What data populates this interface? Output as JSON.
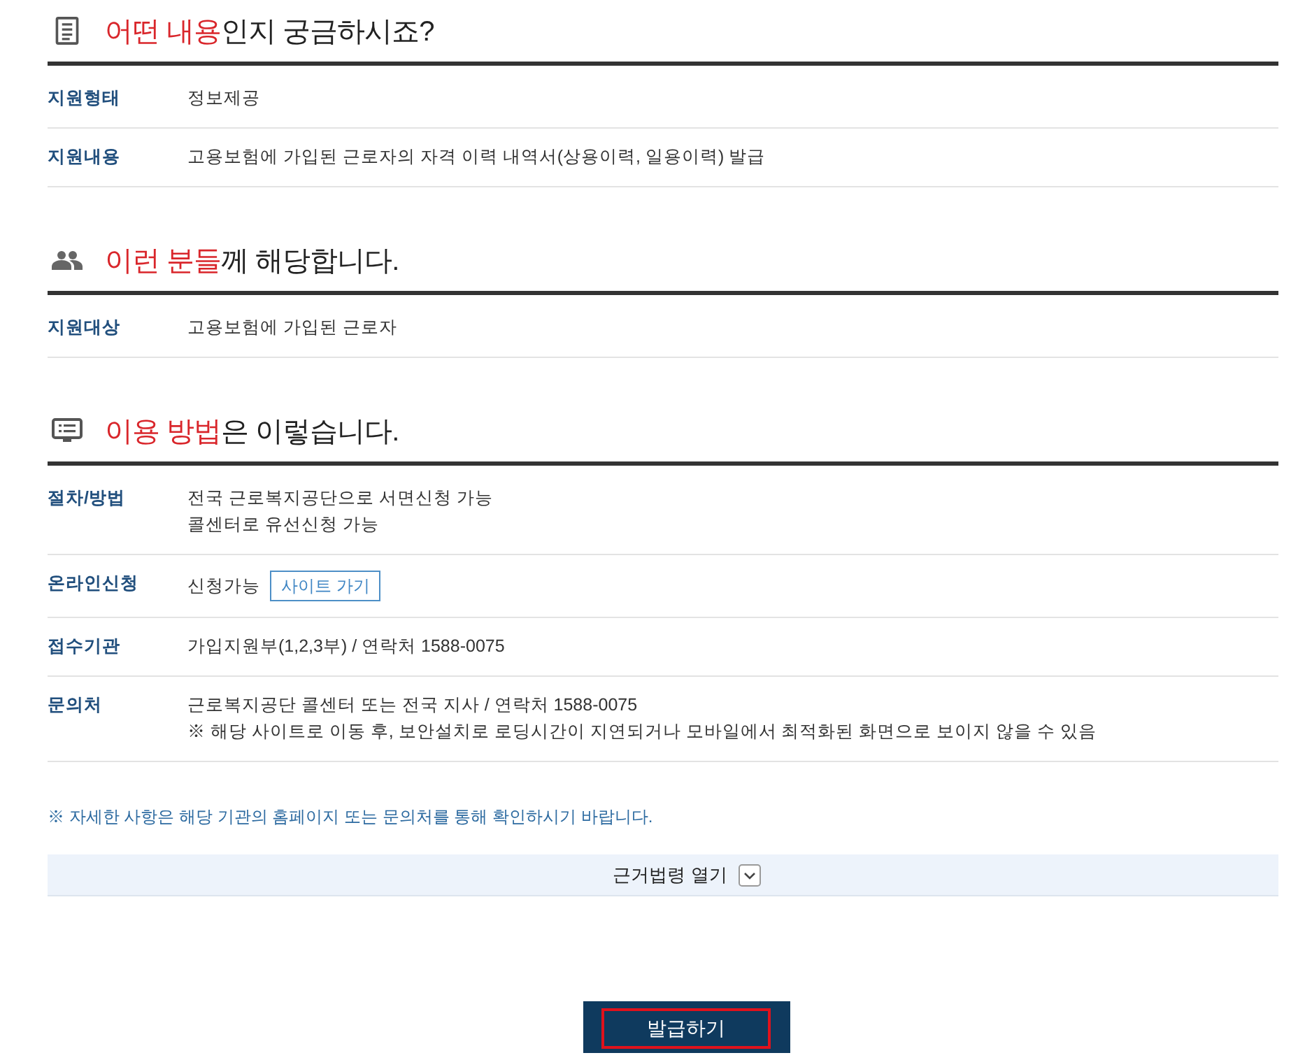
{
  "sections": [
    {
      "kind": "document",
      "title_highlight": "어떤 내용",
      "title_rest": "인지 궁금하시죠?",
      "rows": [
        {
          "label": "지원형태",
          "lines": [
            "정보제공"
          ]
        },
        {
          "label": "지원내용",
          "lines": [
            "고용보험에 가입된 근로자의 자격 이력 내역서(상용이력, 일용이력) 발급"
          ]
        }
      ]
    },
    {
      "kind": "people",
      "title_highlight": "이런 분들",
      "title_rest": "께 해당합니다.",
      "rows": [
        {
          "label": "지원대상",
          "lines": [
            "고용보험에 가입된 근로자"
          ]
        }
      ]
    },
    {
      "kind": "screen",
      "title_highlight": "이용 방법",
      "title_rest": "은 이렇습니다.",
      "rows": [
        {
          "label": "절차/방법",
          "lines": [
            "전국 근로복지공단으로 서면신청 가능",
            "콜센터로 유선신청 가능"
          ]
        },
        {
          "label": "온라인신청",
          "lines": [
            "신청가능"
          ],
          "link": "사이트 가기"
        },
        {
          "label": "접수기관",
          "lines": [
            "가입지원부(1,2,3부) / 연락처 1588-0075"
          ]
        },
        {
          "label": "문의처",
          "lines": [
            "근로복지공단 콜센터 또는 전국 지사 / 연락처 1588-0075",
            "※ 해당 사이트로 이동 후, 보안설치로 로딩시간이 지연되거나 모바일에서 최적화된 화면으로 보이지 않을 수 있음"
          ]
        }
      ]
    }
  ],
  "note": "※ 자세한 사항은 해당 기관의 홈페이지 또는 문의처를 통해 확인하시기 바랍니다.",
  "law_toggle": {
    "label": "근거법령 열기",
    "expanded": false
  },
  "issue_button": {
    "label": "발급하기",
    "focused": true
  }
}
